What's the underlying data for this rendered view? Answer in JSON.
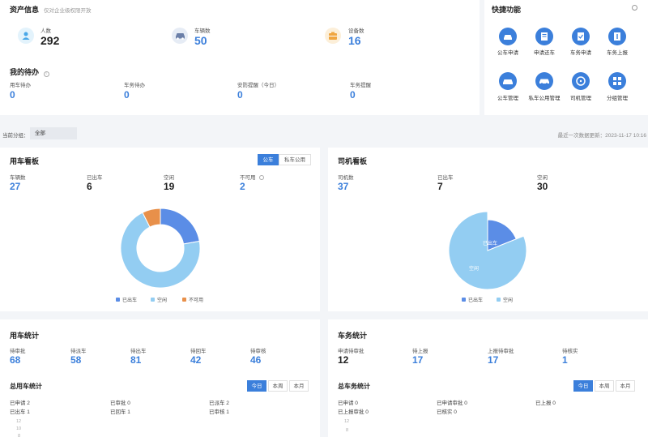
{
  "asset": {
    "title": "资产信息",
    "subtitle": "仅对企业级权限开放",
    "items": [
      {
        "label": "人数",
        "value": "292",
        "icon": "person-icon",
        "color": "#4aa8e8"
      },
      {
        "label": "车辆数",
        "value": "50",
        "icon": "car-icon",
        "color": "#6b7fa8"
      },
      {
        "label": "设备数",
        "value": "16",
        "icon": "device-icon",
        "color": "#f0a640"
      }
    ]
  },
  "todo": {
    "title": "我的待办",
    "items": [
      {
        "label": "用车待办",
        "value": "0"
      },
      {
        "label": "车务待办",
        "value": "0"
      },
      {
        "label": "安防提醒（今日）",
        "value": "0"
      },
      {
        "label": "车务提醒",
        "value": "0"
      }
    ]
  },
  "quick": {
    "title": "快捷功能",
    "items": [
      "公车申请",
      "申请还车",
      "车务申请",
      "车务上报",
      "公车管理",
      "私车公用管理",
      "司机管理",
      "分组管理"
    ]
  },
  "filter": {
    "label": "当前分组：",
    "value": "全部",
    "updated": "最近一次数据更新：2023-11-17 10:16"
  },
  "car_board": {
    "title": "用车看板",
    "tabs": [
      "公车",
      "私车公用"
    ],
    "stats": [
      {
        "label": "车辆数",
        "value": "27",
        "blue": true
      },
      {
        "label": "已出车",
        "value": "6",
        "blue": false
      },
      {
        "label": "空闲",
        "value": "19",
        "blue": false
      },
      {
        "label": "不可用",
        "value": "2",
        "blue": true
      }
    ],
    "legend": [
      "已出车",
      "空闲",
      "不可用"
    ]
  },
  "driver_board": {
    "title": "司机看板",
    "stats": [
      {
        "label": "司机数",
        "value": "37",
        "blue": true
      },
      {
        "label": "已出车",
        "value": "7",
        "blue": false
      },
      {
        "label": "空闲",
        "value": "30",
        "blue": false
      }
    ],
    "legend": [
      "已出车",
      "空闲"
    ],
    "slice_labels": [
      "已出车",
      "空闲"
    ]
  },
  "car_stats": {
    "title": "用车统计",
    "items": [
      {
        "label": "待审批",
        "value": "68"
      },
      {
        "label": "待派车",
        "value": "58"
      },
      {
        "label": "待出车",
        "value": "81"
      },
      {
        "label": "待回车",
        "value": "42"
      },
      {
        "label": "待审核",
        "value": "46"
      }
    ],
    "total_title": "总用车统计",
    "periods": [
      "今日",
      "本周",
      "本月"
    ],
    "details": [
      "已申请  2",
      "已审批  0",
      "已派车  2",
      "已出车  1",
      "已回车  1",
      "已审核  1"
    ],
    "axis": [
      "12",
      "10",
      "8"
    ]
  },
  "service_stats": {
    "title": "车务统计",
    "items": [
      {
        "label": "申请待审批",
        "value": "12"
      },
      {
        "label": "待上报",
        "value": "17"
      },
      {
        "label": "上报待审批",
        "value": "17"
      },
      {
        "label": "待核实",
        "value": "1"
      }
    ],
    "total_title": "总车务统计",
    "periods": [
      "今日",
      "本周",
      "本月"
    ],
    "details": [
      "已申请  0",
      "已申请审批  0",
      "已上报  0",
      "已上报审批  0",
      "已核实  0"
    ],
    "axis": [
      "12",
      "8"
    ]
  },
  "chart_data": [
    {
      "type": "pie",
      "categories": [
        "已出车",
        "空闲",
        "不可用"
      ],
      "values": [
        6,
        19,
        2
      ],
      "colors": [
        "#5b8de6",
        "#93cdf2",
        "#e8904a"
      ]
    },
    {
      "type": "pie",
      "categories": [
        "已出车",
        "空闲"
      ],
      "values": [
        7,
        30
      ],
      "colors": [
        "#5b8de6",
        "#93cdf2"
      ]
    }
  ]
}
